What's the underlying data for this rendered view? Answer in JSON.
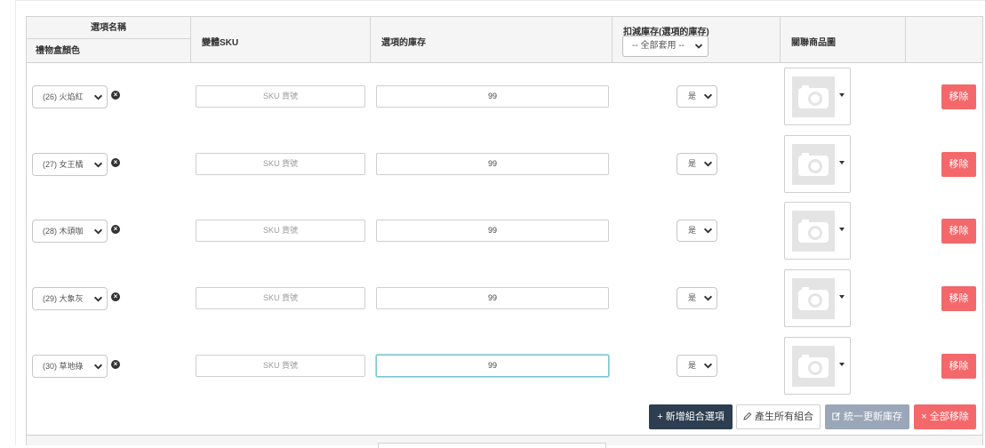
{
  "table": {
    "headers": {
      "option_name": "選項名稱",
      "option_group": "禮物盒顏色",
      "variant_sku": "變體SKU",
      "option_stock": "選項的庫存",
      "deduct_stock": "扣減庫存(選項的庫存)",
      "deduct_apply_all": "-- 全部套用 --",
      "product_image": "關聯商品圖"
    },
    "rows": [
      {
        "option": "(26) 火焰紅",
        "sku_placeholder": "SKU 貨號",
        "stock": "99",
        "deduct": "是",
        "remove_label": "移除"
      },
      {
        "option": "(27) 女王橘",
        "sku_placeholder": "SKU 貨號",
        "stock": "99",
        "deduct": "是",
        "remove_label": "移除"
      },
      {
        "option": "(28) 木頭咖",
        "sku_placeholder": "SKU 貨號",
        "stock": "99",
        "deduct": "是",
        "remove_label": "移除"
      },
      {
        "option": "(29) 大象灰",
        "sku_placeholder": "SKU 貨號",
        "stock": "99",
        "deduct": "是",
        "remove_label": "移除"
      },
      {
        "option": "(30) 草地綠",
        "sku_placeholder": "SKU 貨號",
        "stock": "99",
        "deduct": "是",
        "remove_label": "移除"
      }
    ]
  },
  "actions": {
    "add_combo": "新增組合選項",
    "generate_all": "產生所有組合",
    "update_stock": "統一更新庫存",
    "remove_all": "全部移除",
    "add_icon": "+",
    "remove_all_icon": "×"
  },
  "icons": {
    "remove_option": "×"
  },
  "colors": {
    "remove": "#f4686b",
    "add_button": "#2c3e50",
    "update_button": "#9aa7b8",
    "focus_border": "#7fc5cf"
  }
}
